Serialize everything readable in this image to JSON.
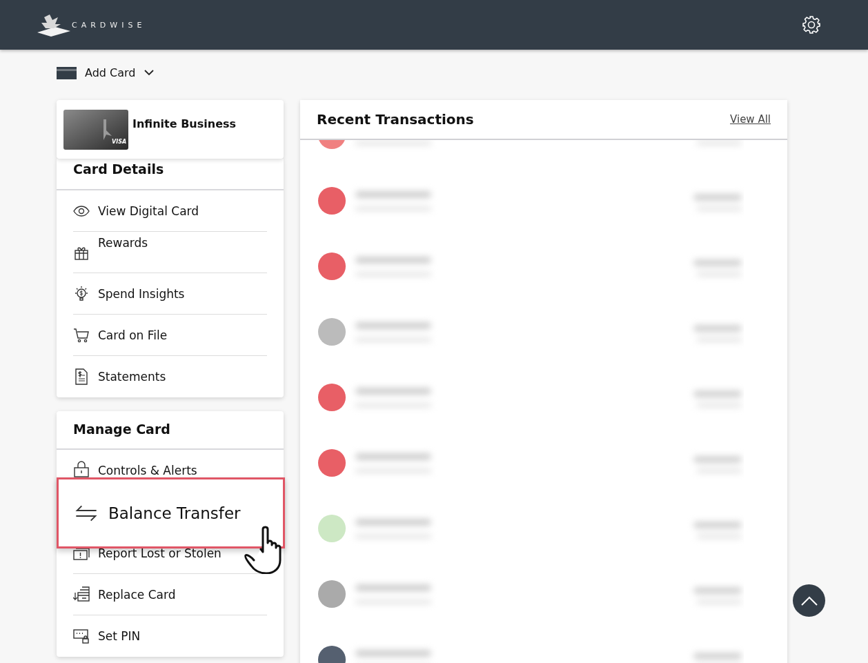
{
  "header": {
    "brand": "CARDWISE"
  },
  "add_card": {
    "label": "Add Card"
  },
  "card": {
    "name": "Infinite Business",
    "network": "VISA"
  },
  "card_details": {
    "title": "Card Details",
    "items": [
      {
        "label": "View Digital Card",
        "selected": false
      },
      {
        "label": "Rewards",
        "selected": false
      },
      {
        "label": "Spend Insights",
        "selected": false
      },
      {
        "label": "Card on File",
        "selected": false
      },
      {
        "label": "Statements",
        "selected": false
      }
    ]
  },
  "manage_card": {
    "title": "Manage Card",
    "items": [
      {
        "label": "Controls & Alerts",
        "selected": false
      },
      {
        "label": "Balance Transfer",
        "selected": true
      },
      {
        "label": "Report Lost or Stolen",
        "selected": false
      },
      {
        "label": "Replace Card",
        "selected": false
      },
      {
        "label": "Set PIN",
        "selected": false
      }
    ]
  },
  "transactions": {
    "title": "Recent Transactions",
    "view_all": "View All",
    "rows": [
      {
        "color": "#f08080"
      },
      {
        "color": "#e85f66"
      },
      {
        "color": "#e85f66"
      },
      {
        "color": "#bbbbbb"
      },
      {
        "color": "#e85f66"
      },
      {
        "color": "#e85f66"
      },
      {
        "color": "#cde8c4"
      },
      {
        "color": "#aaaaaa"
      },
      {
        "color": "#556070"
      }
    ]
  }
}
